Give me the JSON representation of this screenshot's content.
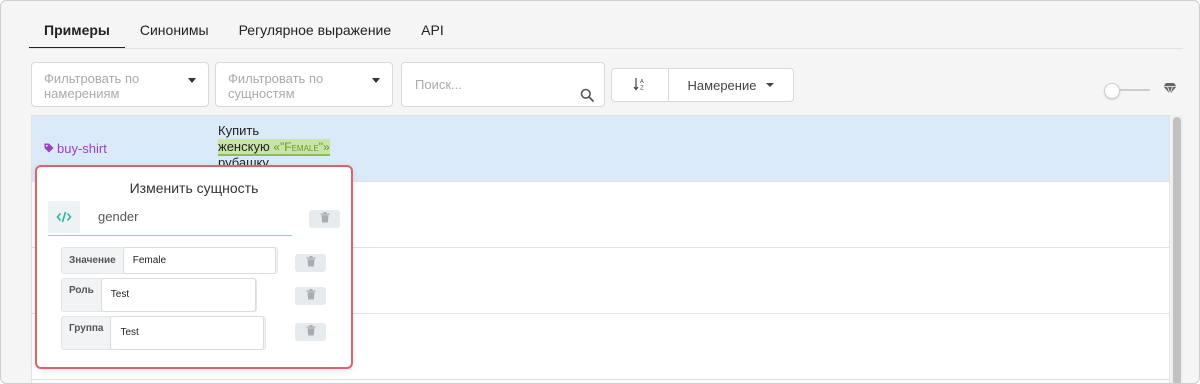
{
  "tabs": [
    {
      "label": "Примеры",
      "active": true
    },
    {
      "label": "Синонимы",
      "active": false
    },
    {
      "label": "Регулярное выражение",
      "active": false
    },
    {
      "label": "API",
      "active": false
    }
  ],
  "filters": {
    "intents_placeholder": "Фильтровать по намерениям",
    "entities_placeholder": "Фильтровать по сущностям",
    "search_placeholder": "Поиск...",
    "sort_label": "Намерение"
  },
  "rows": [
    {
      "intent": "buy-shirt",
      "text_before": "Купить",
      "entity_text": "женскую",
      "entity_label": "«\"Female\"»",
      "text_after": "рубашку"
    }
  ],
  "popup": {
    "title": "Изменить сущность",
    "entity_name": "gender",
    "fields": [
      {
        "label": "Значение",
        "value": "Female"
      },
      {
        "label": "Роль",
        "value": "Test"
      },
      {
        "label": "Группа",
        "value": "Test"
      }
    ]
  },
  "colors": {
    "intent": "#9b3fc4",
    "entity_highlight": "#c9e4a7",
    "popup_border": "#e0616b",
    "selected_row": "#dbeaf8"
  }
}
